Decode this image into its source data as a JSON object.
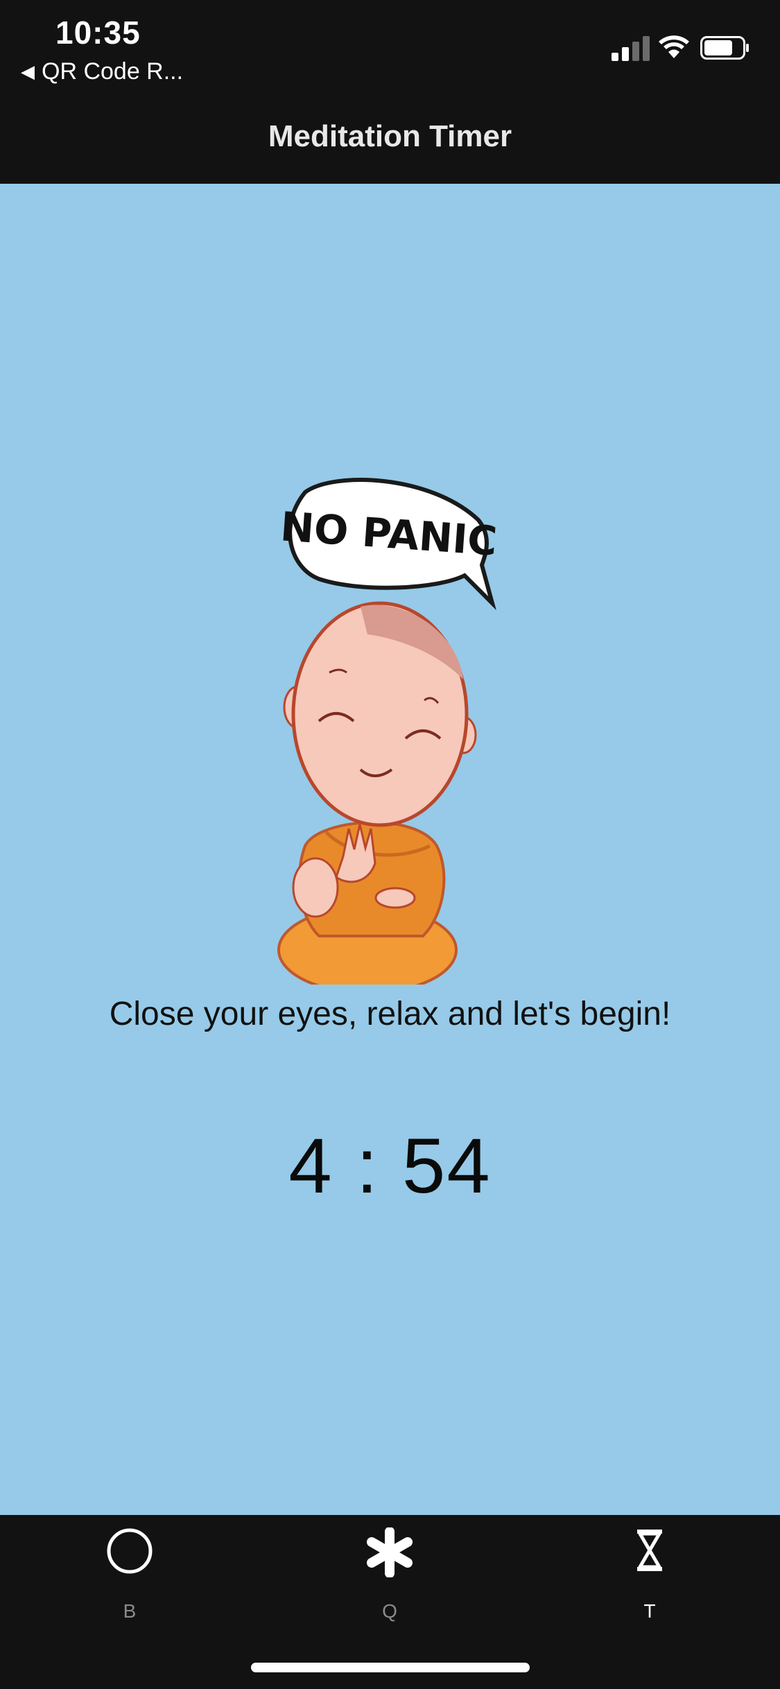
{
  "status_bar": {
    "time": "10:35",
    "back_app": "QR Code R...",
    "back_icon": "back-triangle-icon",
    "icons": [
      "cellular-signal-icon",
      "wifi-icon",
      "battery-icon"
    ]
  },
  "nav": {
    "title": "Meditation Timer"
  },
  "main": {
    "background_color": "#96cae8",
    "illustration": {
      "speech_bubble_text": "NO PANIC",
      "description_icon": "meditating-monk-illustration"
    },
    "message": "Close your eyes, relax and let's begin!",
    "timer": "4 : 54"
  },
  "tab_bar": {
    "tabs": [
      {
        "label": "B",
        "icon": "circle-icon",
        "active": false
      },
      {
        "label": "Q",
        "icon": "asterisk-icon",
        "active": false
      },
      {
        "label": "T",
        "icon": "hourglass-icon",
        "active": true
      }
    ]
  }
}
